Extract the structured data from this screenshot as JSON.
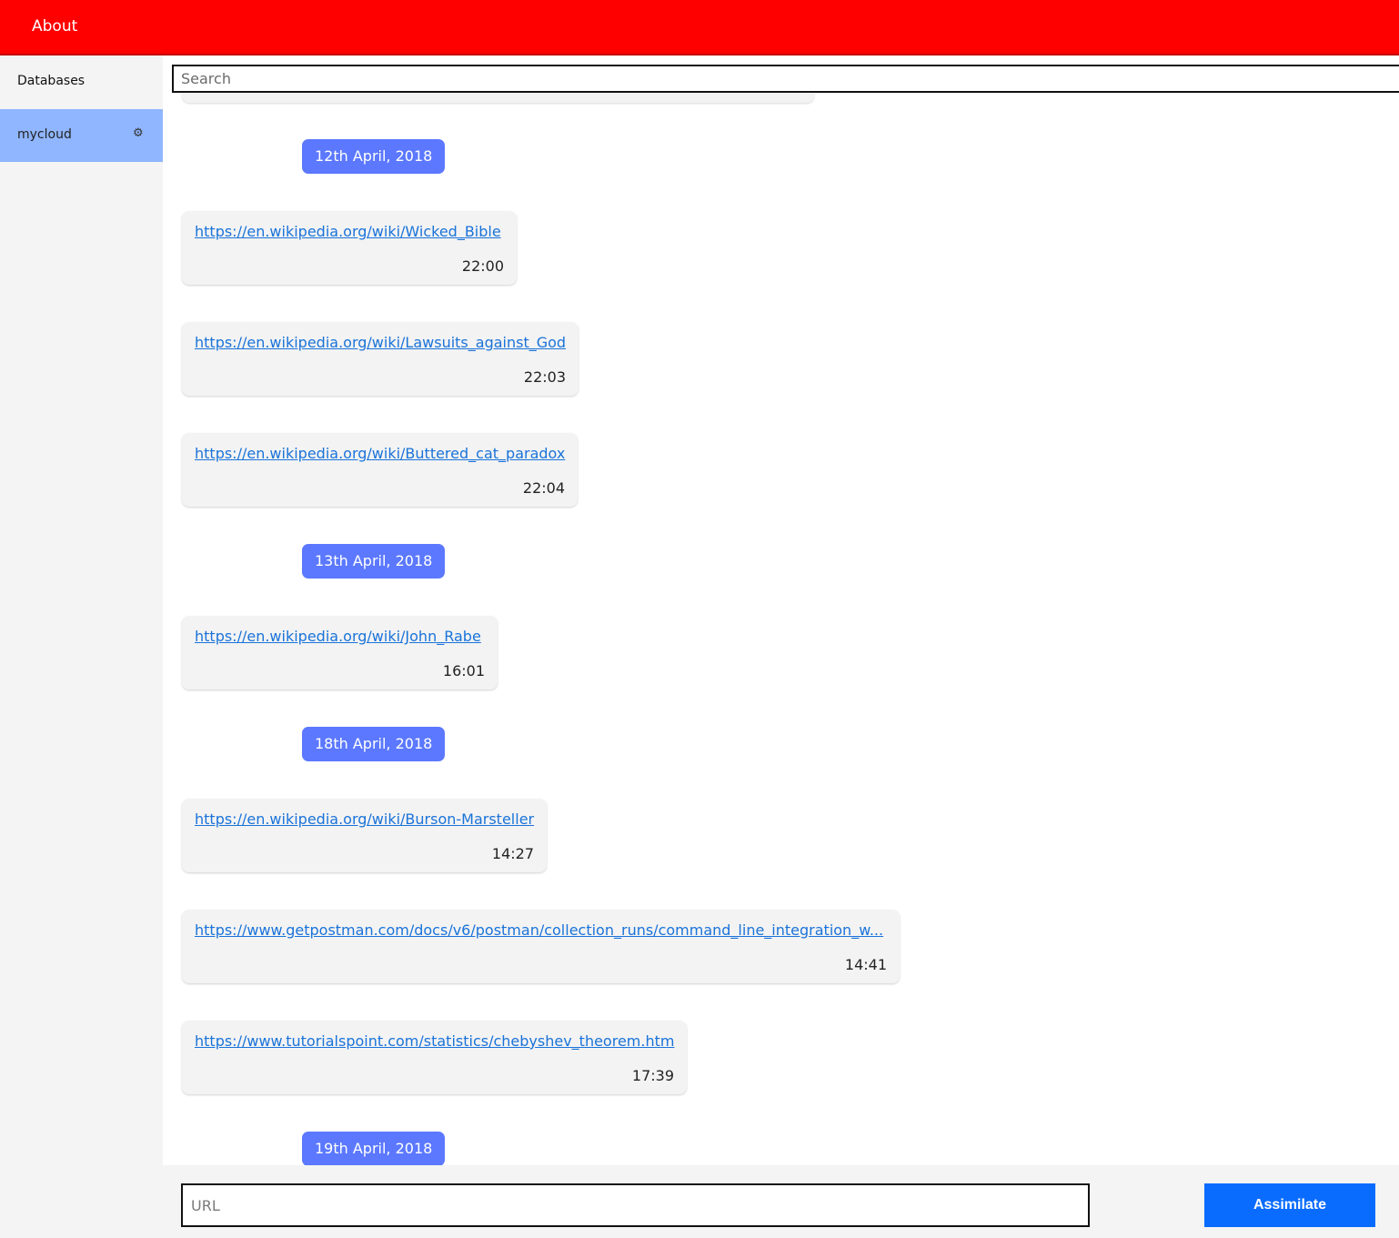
{
  "topbar": {
    "about_label": "About"
  },
  "sidebar": {
    "header": "Databases",
    "databases": [
      {
        "name": "mycloud",
        "selected": true
      }
    ]
  },
  "search": {
    "placeholder": "Search",
    "value": ""
  },
  "feed": {
    "dates": [
      "12th April, 2018",
      "13th April, 2018",
      "18th April, 2018",
      "19th April, 2018"
    ],
    "links": [
      {
        "url": "https://en.wikipedia.org/wiki/Wicked_Bible",
        "time": "22:00"
      },
      {
        "url": "https://en.wikipedia.org/wiki/Lawsuits_against_God",
        "time": "22:03"
      },
      {
        "url": "https://en.wikipedia.org/wiki/Buttered_cat_paradox",
        "time": "22:04"
      },
      {
        "url": "https://en.wikipedia.org/wiki/John_Rabe",
        "time": "16:01"
      },
      {
        "url": "https://en.wikipedia.org/wiki/Burson-Marsteller",
        "time": "14:27"
      },
      {
        "url": "https://www.getpostman.com/docs/v6/postman/collection_runs/command_line_integration_w...",
        "time": "14:41"
      },
      {
        "url": "https://www.tutorialspoint.com/statistics/chebyshev_theorem.htm",
        "time": "17:39"
      }
    ]
  },
  "bottom": {
    "url_placeholder": "URL",
    "url_value": "",
    "assimilate_label": "Assimilate"
  },
  "colors": {
    "topbar": "#ff0000",
    "selected_db": "#8fb6ff",
    "date_pill": "#5b78ff",
    "link": "#1a73d9",
    "primary_button": "#0a6cff"
  }
}
